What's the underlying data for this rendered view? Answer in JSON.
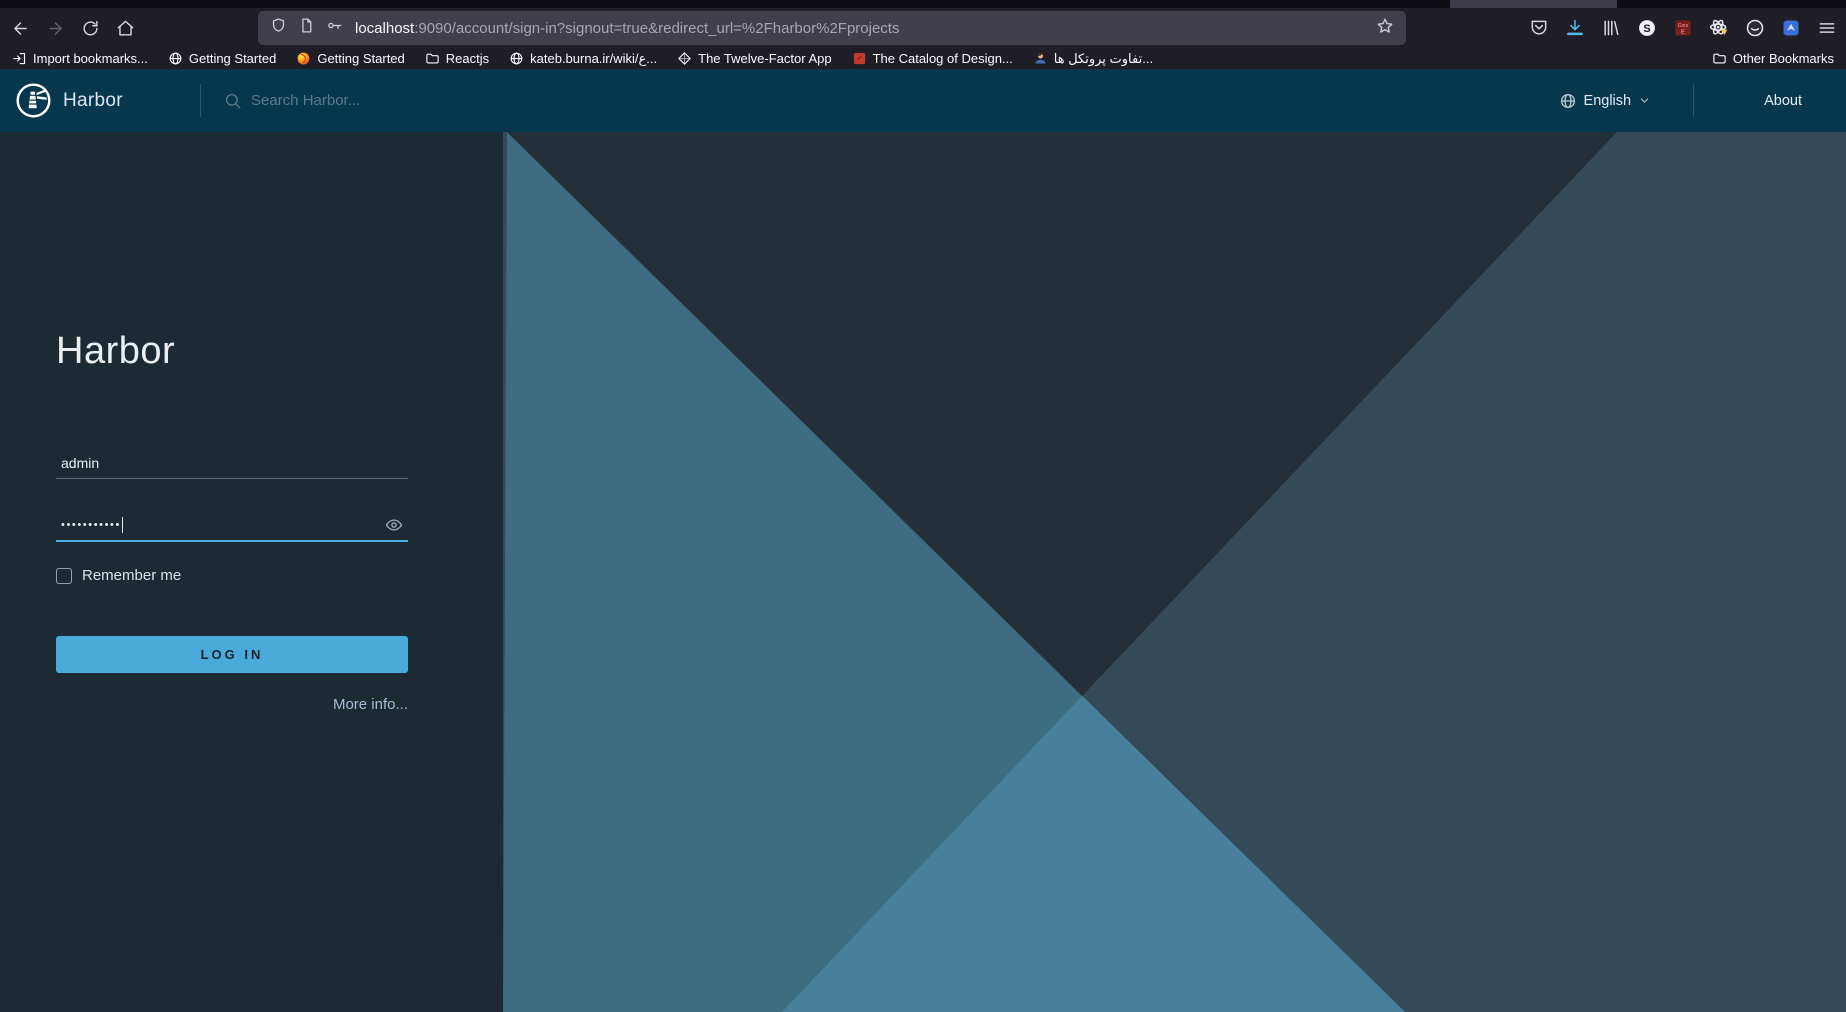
{
  "browser": {
    "url": {
      "host": "localhost",
      "rest": ":9090/account/sign-in?signout=true&redirect_url=%2Fharbor%2Fprojects"
    },
    "bookmarks": [
      {
        "label": "Import bookmarks...",
        "icon": "import-icon"
      },
      {
        "label": "Getting Started",
        "icon": "globe-icon"
      },
      {
        "label": "Getting Started",
        "icon": "firefox-icon"
      },
      {
        "label": "Reactjs",
        "icon": "folder-icon"
      },
      {
        "label": "kateb.burna.ir/wiki/ع...",
        "icon": "globe-icon"
      },
      {
        "label": "The Twelve-Factor App",
        "icon": "diamond-icon"
      },
      {
        "label": "The Catalog of Design...",
        "icon": "red-site-icon"
      },
      {
        "label": "تفاوت پروتکل ها...",
        "icon": "person-icon"
      }
    ],
    "other_bookmarks": "Other Bookmarks"
  },
  "header": {
    "brand": "Harbor",
    "search_placeholder": "Search Harbor...",
    "language": "English",
    "about": "About"
  },
  "login": {
    "title": "Harbor",
    "username": "admin",
    "password_masked": "•••••••••••",
    "remember_label": "Remember me",
    "submit_label": "LOG IN",
    "more_info_label": "More info..."
  },
  "colors": {
    "accent_blue": "#49afd9",
    "button_blue": "#4aabdb",
    "header_bg": "#06374e",
    "panel_bg": "#1c2a33",
    "bg_gray_blue": "#344a58",
    "bg_teal": "#3e6c81",
    "bg_navy": "#242f3a",
    "bg_bright_teal": "#48809b"
  }
}
